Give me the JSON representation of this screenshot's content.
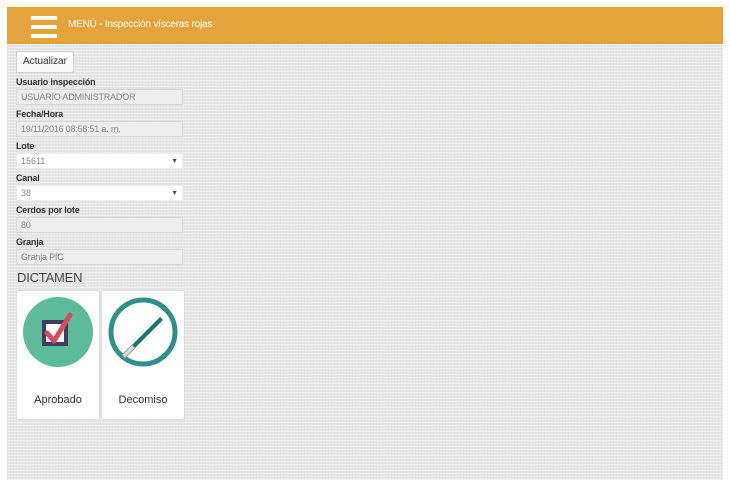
{
  "header": {
    "menu_title": "MENÚ - Inspección vísceras rojas",
    "bar_color": "#e5a33c"
  },
  "toolbar": {
    "refresh_label": "Actualizar"
  },
  "form": {
    "usuario": {
      "label": "Usuario inspección",
      "value": "USUARIO ADMINISTRADOR"
    },
    "fecha": {
      "label": "Fecha/Hora",
      "value": "19/11/2016 08:58:51 a. m."
    },
    "lote": {
      "label": "Lote",
      "value": "15611"
    },
    "canal": {
      "label": "Canal",
      "value": "38"
    },
    "cerdos": {
      "label": "Cerdos por lote",
      "value": "80"
    },
    "granja": {
      "label": "Granja",
      "value": "Granja PIC"
    }
  },
  "dictamen": {
    "title": "DICTAMEN",
    "options": [
      {
        "label": "Aprobado",
        "icon": "checkbox-check-icon",
        "color": "#5dbb9c"
      },
      {
        "label": "Decomiso",
        "icon": "scalpel-icon",
        "color": "#2e8f8b"
      }
    ]
  }
}
